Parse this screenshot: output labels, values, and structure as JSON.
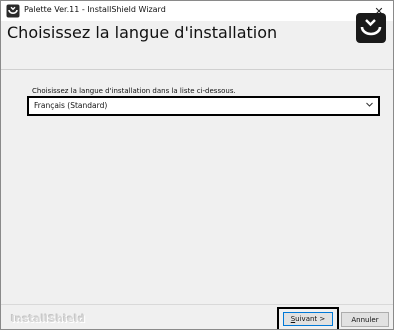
{
  "window": {
    "title": "Palette Ver.11 - InstallShield Wizard",
    "close_glyph": "✕"
  },
  "header": {
    "title": "Choisissez la langue d'installation",
    "logo_icon": "installshield-logo-icon"
  },
  "main": {
    "instruction": "Choisissez la langue d'installation dans la liste ci-dessous.",
    "language_select": {
      "selected": "Français (Standard)",
      "arrow_icon": "chevron-down-icon"
    }
  },
  "footer": {
    "brand": "InstallShield",
    "next_label_underlined": "S",
    "next_label_rest": "uivant >",
    "cancel_label": "Annuler"
  },
  "colors": {
    "accent": "#0078d7",
    "highlight_border": "#000000",
    "logo_dark": "#1a1a1a"
  }
}
